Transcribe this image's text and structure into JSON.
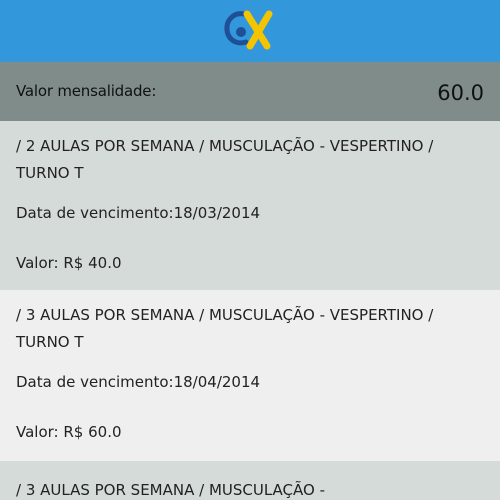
{
  "summary": {
    "label": "Valor mensalidade:",
    "value": "60.0"
  },
  "payments": [
    {
      "title": "/ 2 AULAS POR SEMANA / MUSCULAÇÃO - VESPERTINO / TURNO T",
      "due_label": "Data de vencimento:",
      "due_date": "18/03/2014",
      "amount_label": "Valor:",
      "amount": "R$ 40.0"
    },
    {
      "title": "/ 3 AULAS POR SEMANA / MUSCULAÇÃO - VESPERTINO / TURNO T",
      "due_label": "Data de vencimento:",
      "due_date": "18/04/2014",
      "amount_label": "Valor:",
      "amount": "R$ 60.0"
    },
    {
      "title": "/ 3 AULAS POR SEMANA / MUSCULAÇÃO -"
    }
  ],
  "colors": {
    "header": "#3397dc",
    "summary": "#7f8c8a",
    "card_highlight": "#d5dbd8",
    "card_normal": "#efefef",
    "logo_blue": "#1f4f96",
    "logo_yellow": "#f5c400"
  }
}
